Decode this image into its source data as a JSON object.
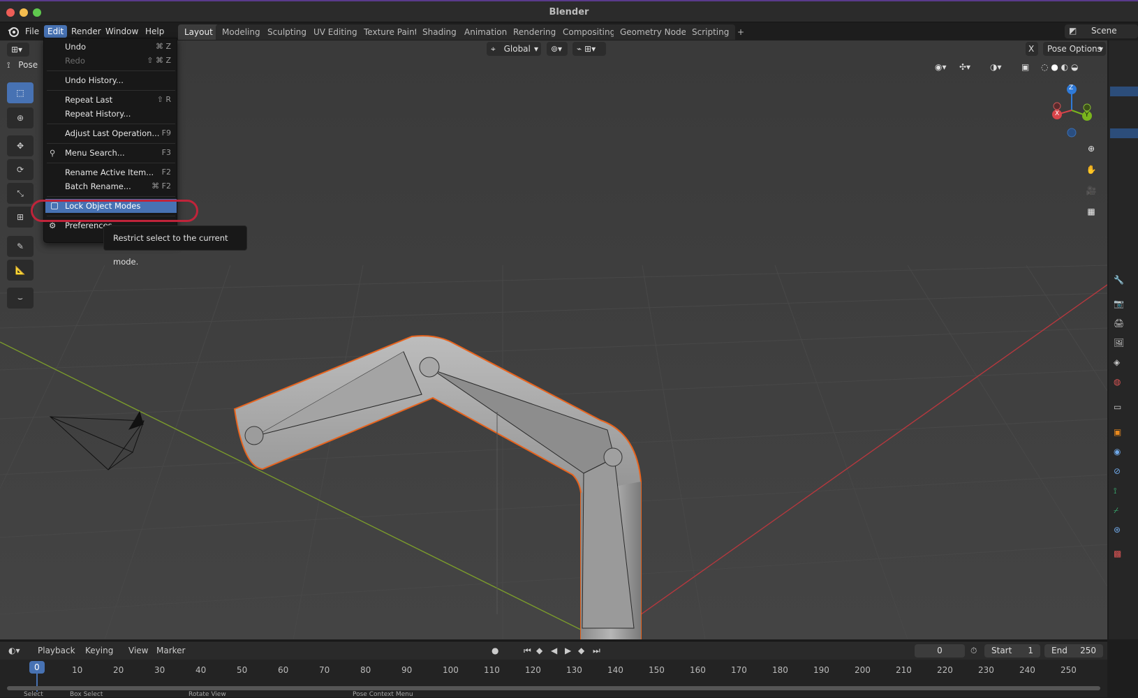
{
  "window": {
    "title": "Blender"
  },
  "menubar": {
    "items": [
      "File",
      "Edit",
      "Render",
      "Window",
      "Help"
    ],
    "active": "Edit"
  },
  "workspaces": {
    "tabs": [
      "Layout",
      "Modeling",
      "Sculpting",
      "UV Editing",
      "Texture Paint",
      "Shading",
      "Animation",
      "Rendering",
      "Compositing",
      "Geometry Nodes",
      "Scripting"
    ],
    "active": "Layout",
    "add": "+"
  },
  "scene": {
    "label": "Scene"
  },
  "viewport_header": {
    "mode": "Pose",
    "orientation": "Global",
    "pose_options": "Pose Options",
    "x_label": "X"
  },
  "edit_menu": {
    "undo": {
      "label": "Undo",
      "shortcut": "⌘ Z"
    },
    "redo": {
      "label": "Redo",
      "shortcut": "⇧ ⌘ Z"
    },
    "undo_history": {
      "label": "Undo History..."
    },
    "repeat_last": {
      "label": "Repeat Last",
      "shortcut": "⇧ R"
    },
    "repeat_history": {
      "label": "Repeat History..."
    },
    "adjust_last": {
      "label": "Adjust Last Operation...",
      "shortcut": "F9"
    },
    "menu_search": {
      "label": "Menu Search...",
      "shortcut": "F3"
    },
    "rename_active": {
      "label": "Rename Active Item...",
      "shortcut": "F2"
    },
    "batch_rename": {
      "label": "Batch Rename...",
      "shortcut": "⌘ F2"
    },
    "lock_object_modes": {
      "label": "Lock Object Modes"
    },
    "preferences": {
      "label": "Preferences"
    }
  },
  "tooltip": {
    "text": "Restrict select to the current mode."
  },
  "gizmo": {
    "z": "Z",
    "y": "Y",
    "x": "X"
  },
  "timeline": {
    "playback": "Playback",
    "keying": "Keying",
    "view": "View",
    "marker": "Marker",
    "current_frame": "0",
    "start_label": "Start",
    "start_value": "1",
    "end_label": "End",
    "end_value": "250",
    "ruler": [
      "0",
      "10",
      "20",
      "30",
      "40",
      "50",
      "60",
      "70",
      "80",
      "90",
      "100",
      "110",
      "120",
      "130",
      "140",
      "150",
      "160",
      "170",
      "180",
      "190",
      "200",
      "210",
      "220",
      "230",
      "240",
      "250"
    ]
  },
  "statusbar": {
    "select": "Select",
    "box_select": "Box Select",
    "rotate_view": "Rotate View",
    "context_menu": "Pose Context Menu"
  },
  "colors": {
    "accent": "#4772b3",
    "highlight_ring": "#c0243a",
    "outline": "#e8641e",
    "x_axis": "#b5383e",
    "y_axis": "#7a9a2c"
  }
}
